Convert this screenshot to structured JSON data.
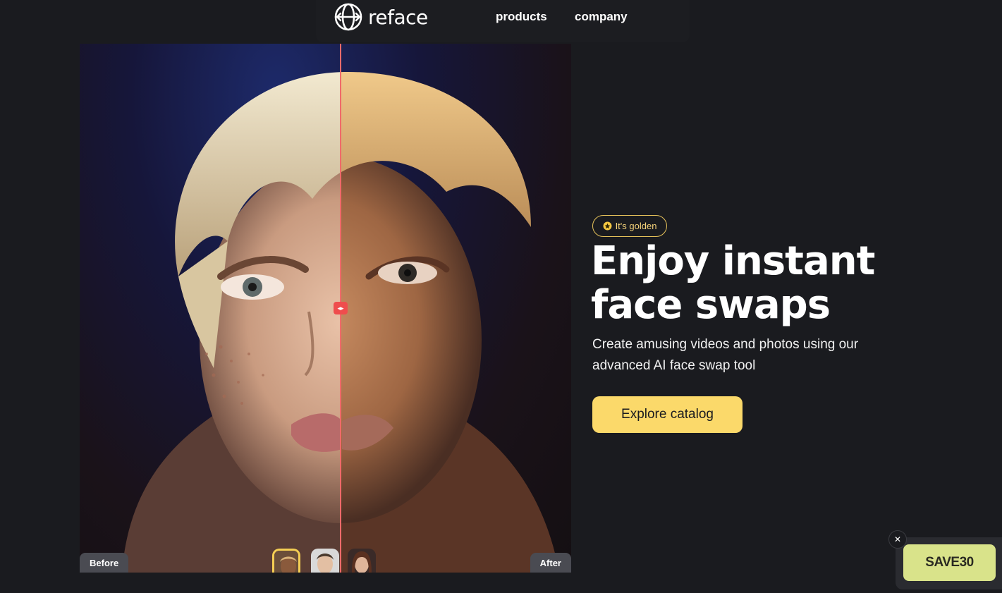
{
  "nav": {
    "logo_text": "reface",
    "links": [
      "products",
      "company"
    ]
  },
  "compare": {
    "before_label": "Before",
    "after_label": "After",
    "divider_icon": "arrows-left-right-icon",
    "thumbnails": [
      "thumb-avatar-1",
      "thumb-avatar-2",
      "thumb-avatar-3"
    ]
  },
  "hero": {
    "badge": "It's golden",
    "badge_icon": "star-icon",
    "headline_line1": "Enjoy instant",
    "headline_line2": "face swaps",
    "subtext": "Create amusing videos and photos using our advanced AI face swap tool",
    "cta_label": "Explore catalog"
  },
  "promo": {
    "code": "SAVE30",
    "close_icon": "close-icon"
  },
  "colors": {
    "background": "#1a1b1f",
    "accent_yellow": "#fbd96a",
    "divider_red": "#ef4d4d",
    "promo_green": "#d9e38a"
  }
}
